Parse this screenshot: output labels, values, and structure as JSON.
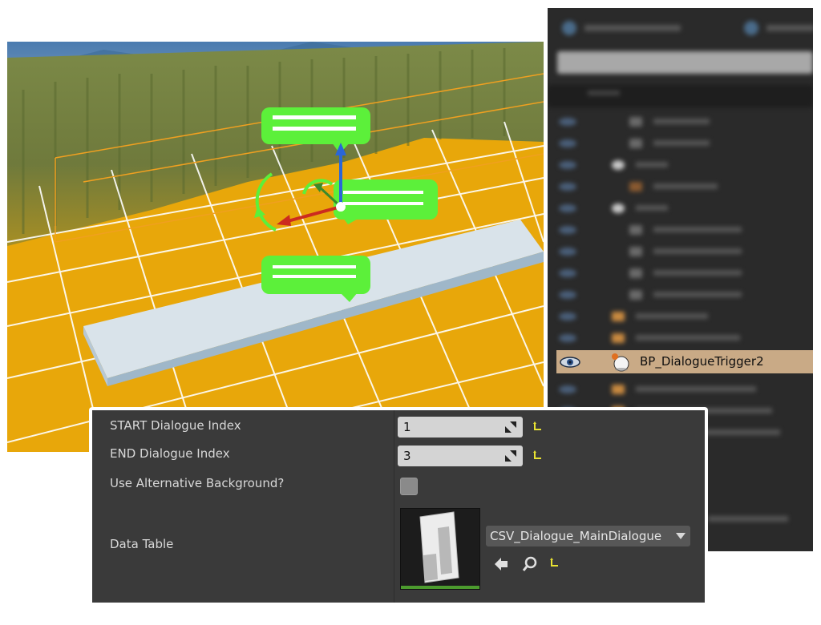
{
  "outliner": {
    "selected_item": {
      "label": "BP_DialogueTrigger2",
      "visibility_icon": "eye-icon",
      "type_icon": "blueprint-actor-icon"
    }
  },
  "details": {
    "properties": [
      {
        "label": "START Dialogue Index",
        "value": "1"
      },
      {
        "label": "END Dialogue Index",
        "value": "3"
      },
      {
        "label": "Use Alternative Background?",
        "checked": false
      },
      {
        "label": "Data Table",
        "asset": "CSV_Dialogue_MainDialogue"
      }
    ]
  },
  "colors": {
    "floor": "#e8a70a",
    "selection_highlight": "#c9aa86",
    "panel_bg": "#3a3a3a",
    "billboard_green": "#5cf03a"
  }
}
